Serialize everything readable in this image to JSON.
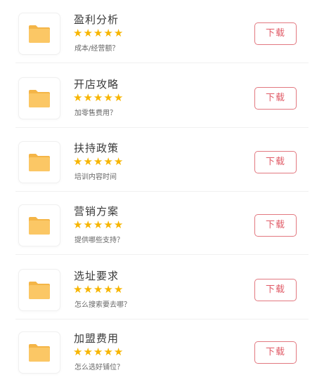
{
  "items": [
    {
      "title": "盈利分析",
      "subtitle": "成本/经营额？",
      "rating": 5,
      "button_label": "下载",
      "icon": "folder-icon"
    },
    {
      "title": "开店攻略",
      "subtitle": "加零售费用？",
      "rating": 5,
      "button_label": "下载",
      "icon": "folder-icon"
    },
    {
      "title": "扶持政策",
      "subtitle": "培训内容时间",
      "rating": 5,
      "button_label": "下载",
      "icon": "folder-icon"
    },
    {
      "title": "营销方案",
      "subtitle": "提供哪些支持？",
      "rating": 5,
      "button_label": "下载",
      "icon": "folder-icon"
    },
    {
      "title": "选址要求",
      "subtitle": "怎么搜索要去哪？",
      "rating": 5,
      "button_label": "下载",
      "icon": "folder-icon"
    },
    {
      "title": "加盟费用",
      "subtitle": "怎么选好铺位？",
      "rating": 5,
      "button_label": "下载",
      "icon": "folder-icon"
    }
  ],
  "colors": {
    "folder": "#fbc765",
    "folder_tab": "#f4b547",
    "star": "#f7b500",
    "button_border": "#e27880",
    "button_text": "#e05a66"
  },
  "star_glyph": "★"
}
